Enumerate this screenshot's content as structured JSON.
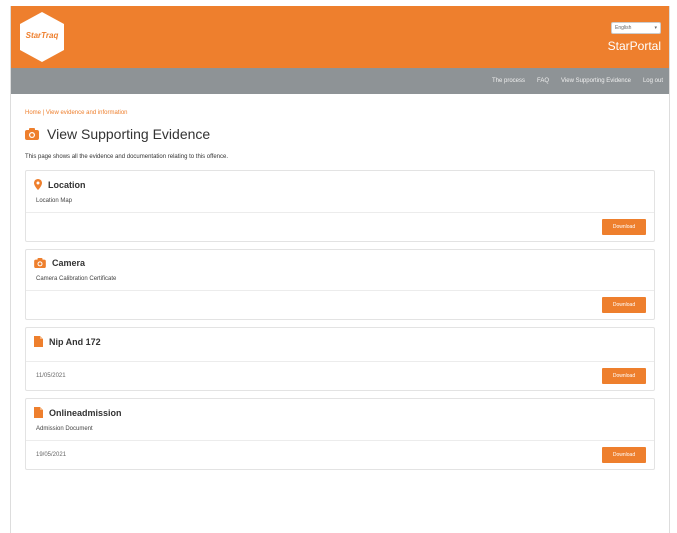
{
  "header": {
    "logo_text": "StarTraq",
    "language": "English",
    "portal_title": "StarPortal"
  },
  "nav": {
    "items": [
      {
        "label": "The process"
      },
      {
        "label": "FAQ"
      },
      {
        "label": "View Supporting Evidence"
      },
      {
        "label": "Log out"
      }
    ]
  },
  "breadcrumb": "Home  |  View evidence and information",
  "page": {
    "title": "View Supporting Evidence",
    "description": "This page shows all the evidence and documentation relating to this offence."
  },
  "cards": [
    {
      "title": "Location",
      "icon": "map-pin-icon",
      "subtitle": "Location Map",
      "date": "",
      "button": "Download"
    },
    {
      "title": "Camera",
      "icon": "camera-icon",
      "subtitle": "Camera Calibration Certificate",
      "date": "",
      "button": "Download"
    },
    {
      "title": "Nip And 172",
      "icon": "document-icon",
      "subtitle": "",
      "date": "11/05/2021",
      "button": "Download"
    },
    {
      "title": "Onlineadmission",
      "icon": "document-icon",
      "subtitle": "Admission Document",
      "date": "19/05/2021",
      "button": "Download"
    }
  ],
  "colors": {
    "brand": "#ee7f2d",
    "nav_bg": "#8e9396"
  }
}
